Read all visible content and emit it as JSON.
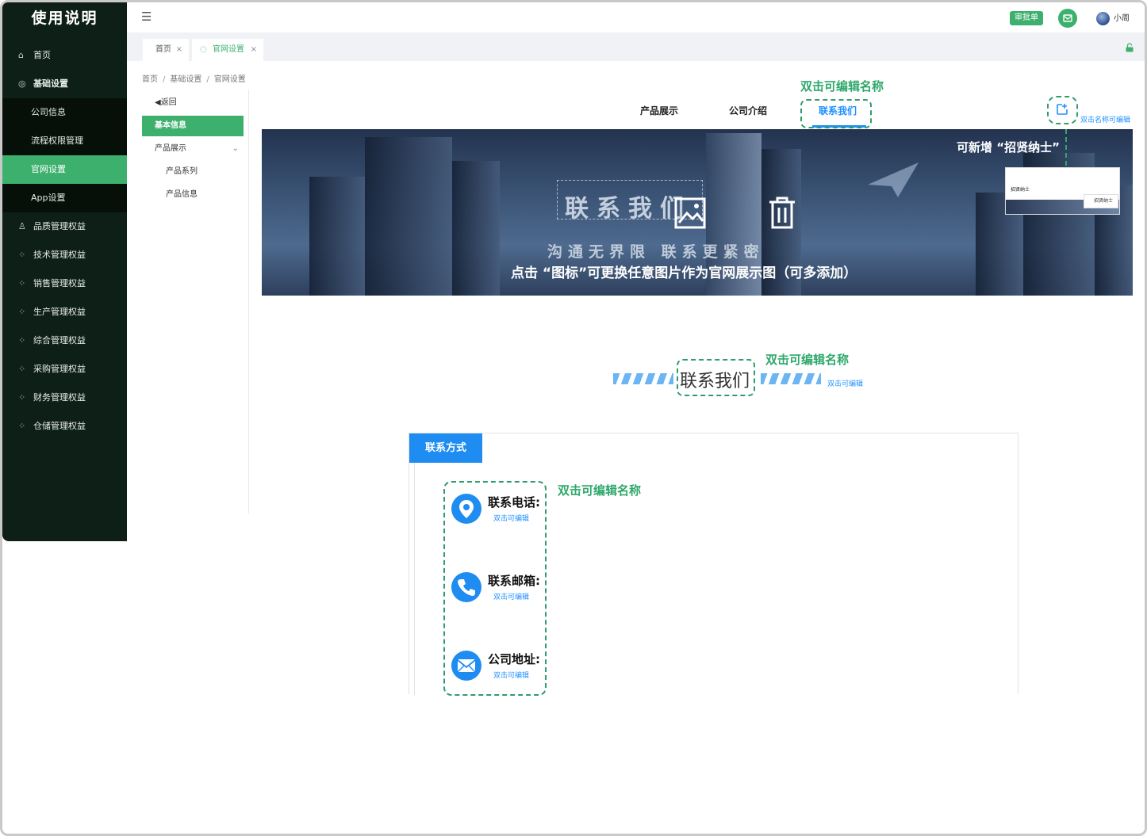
{
  "app": {
    "title": "使用说明"
  },
  "sidebar": {
    "items": [
      {
        "label": "首页",
        "icon": "home-icon"
      },
      {
        "label": "基础设置",
        "icon": "settings-icon"
      },
      {
        "label": "公司信息"
      },
      {
        "label": "流程权限管理"
      },
      {
        "label": "官网设置",
        "active": true
      },
      {
        "label": "App设置"
      },
      {
        "label": "品质管理权益",
        "icon": "user-icon"
      },
      {
        "label": "技术管理权益",
        "icon": "grid-icon"
      },
      {
        "label": "销售管理权益",
        "icon": "grid-icon"
      },
      {
        "label": "生产管理权益",
        "icon": "grid-icon"
      },
      {
        "label": "综合管理权益",
        "icon": "grid-icon"
      },
      {
        "label": "采购管理权益",
        "icon": "grid-icon"
      },
      {
        "label": "财务管理权益",
        "icon": "grid-icon"
      },
      {
        "label": "仓储管理权益",
        "icon": "grid-icon"
      }
    ]
  },
  "header": {
    "approval_label": "审批单",
    "user_name": "小周"
  },
  "tabs": [
    {
      "label": "首页"
    },
    {
      "label": "官网设置",
      "active": true
    }
  ],
  "breadcrumb": [
    "首页",
    "基础设置",
    "官网设置"
  ],
  "subnav": {
    "back": "◀返回",
    "basic_info": "基本信息",
    "product_display": "产品展示",
    "product_series": "产品系列",
    "product_info": "产品信息"
  },
  "site_nav": {
    "tabs": [
      "产品展示",
      "公司介绍",
      "联系我们"
    ],
    "active_index": 2,
    "hint_top": "双击可编辑名称",
    "hint_right": "双击名称可编辑"
  },
  "banner": {
    "title": "联系我们",
    "slogan": "沟通无界限 联系更紧密",
    "tip": "点击 “图标”可更换任意图片作为官网展示图（可多添加）",
    "add_hint": "可新增 “招贤纳士”",
    "thumb_label": "招贤纳士",
    "thumb_menu_label": "招贤纳士"
  },
  "section": {
    "title": "联系我们",
    "hint": "双击可编辑名称",
    "edit_hint": "双击可编辑"
  },
  "contact": {
    "tab_label": "联系方式",
    "hint": "双击可编辑名称",
    "rows": [
      {
        "label": "联系电话:",
        "edit": "双击可编辑",
        "icon": "location-pin-icon"
      },
      {
        "label": "联系邮箱:",
        "edit": "双击可编辑",
        "icon": "phone-icon"
      },
      {
        "label": "公司地址:",
        "edit": "双击可编辑",
        "icon": "envelope-icon"
      }
    ]
  },
  "colors": {
    "sidebar_bg": "#0e1f17",
    "accent_green": "#3eb06e",
    "hint_green": "#2fa86b",
    "accent_blue": "#1e8cf0"
  }
}
